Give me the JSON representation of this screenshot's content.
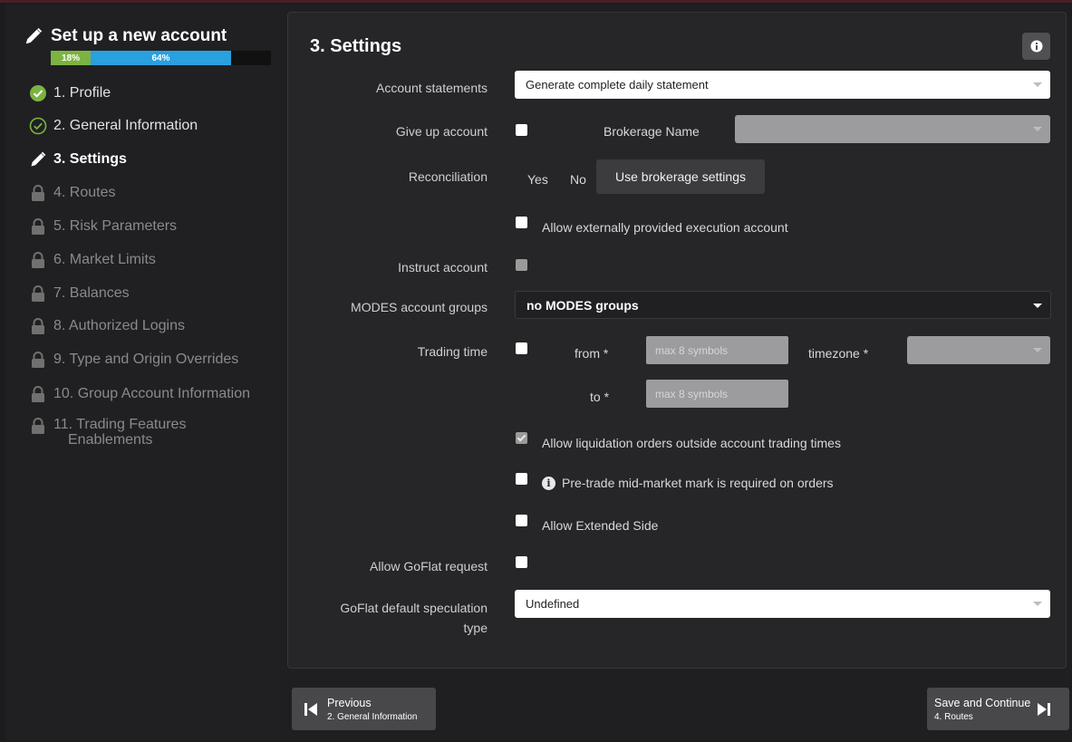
{
  "sidebar": {
    "title": "Set up a new account",
    "progress": {
      "completed_label": "18%",
      "completed_fraction": 0.18,
      "total_label": "64%",
      "total_fraction": 0.64,
      "completed_color": "#7cb342",
      "total_color": "#29a0e0"
    },
    "items": [
      {
        "label": "1. Profile",
        "state": "done",
        "icon": "check-filled-icon"
      },
      {
        "label": "2. General Information",
        "state": "done",
        "icon": "check-outline-icon"
      },
      {
        "label": "3. Settings",
        "state": "active",
        "icon": "pencil-icon"
      },
      {
        "label": "4. Routes",
        "state": "locked",
        "icon": "lock-icon"
      },
      {
        "label": "5. Risk Parameters",
        "state": "locked",
        "icon": "lock-icon"
      },
      {
        "label": "6. Market Limits",
        "state": "locked",
        "icon": "lock-icon"
      },
      {
        "label": "7. Balances",
        "state": "locked",
        "icon": "lock-icon"
      },
      {
        "label": "8. Authorized Logins",
        "state": "locked",
        "icon": "lock-icon"
      },
      {
        "label": "9. Type and Origin Overrides",
        "state": "locked",
        "icon": "lock-icon"
      },
      {
        "label": "10. Group Account Information",
        "state": "locked",
        "icon": "lock-icon"
      },
      {
        "label": "11. Trading Features",
        "label_line2": "Enablements",
        "state": "locked",
        "icon": "lock-icon"
      }
    ]
  },
  "main": {
    "title": "3. Settings",
    "fields": {
      "account_statements": {
        "label": "Account statements",
        "value": "Generate complete daily statement"
      },
      "give_up": {
        "label": "Give up account",
        "brokerage_label": "Brokerage Name",
        "brokerage_value": ""
      },
      "reconciliation": {
        "label": "Reconciliation",
        "yes": "Yes",
        "no": "No",
        "use_brokerage": "Use brokerage settings"
      },
      "allow_external": {
        "label": "Allow externally provided execution account"
      },
      "instruct": {
        "label": "Instruct account"
      },
      "modes": {
        "label": "MODES account groups",
        "value": "no MODES groups"
      },
      "trading_time": {
        "label": "Trading time",
        "from_label": "from *",
        "to_label": "to *",
        "from_placeholder": "max 8 symbols",
        "to_placeholder": "max 8 symbols",
        "timezone_label": "timezone *",
        "timezone_value": ""
      },
      "allow_liquidation": {
        "label": "Allow liquidation orders outside account trading times"
      },
      "pre_trade": {
        "label": "Pre-trade mid-market mark is required on orders"
      },
      "extended_side": {
        "label": "Allow Extended Side"
      },
      "goflat_request": {
        "label": "Allow GoFlat request"
      },
      "goflat_spec": {
        "label_line1": "GoFlat default speculation",
        "label_line2": "type",
        "value": "Undefined"
      }
    }
  },
  "footer": {
    "previous": {
      "label": "Previous",
      "sub": "2. General Information"
    },
    "next": {
      "label": "Save and Continue",
      "sub": "4. Routes"
    }
  }
}
